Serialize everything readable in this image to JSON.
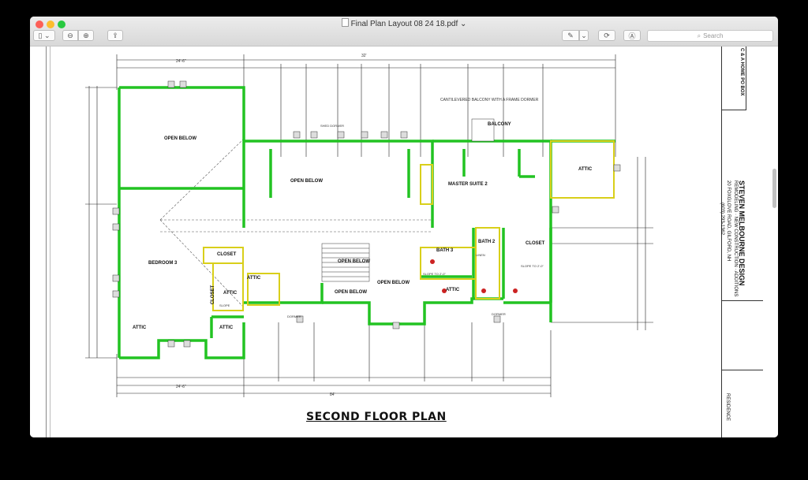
{
  "window": {
    "title": "Final Plan Layout 08 24 18.pdf",
    "title_suffix": "⌄"
  },
  "toolbar": {
    "sidebar_label": "▯ ⌄",
    "zoom_out_label": "⊖",
    "zoom_in_label": "⊕",
    "share_label": "⇪",
    "markup_label": "✎",
    "markup_menu_label": "⌄",
    "rotate_label": "⟳",
    "annotate_label": "Ⓐ",
    "search_placeholder": "Search"
  },
  "plan": {
    "title": "SECOND FLOOR PLAN",
    "rooms": {
      "open_below_1": "OPEN BELOW",
      "open_below_2": "OPEN BELOW",
      "open_below_3": "OPEN BELOW",
      "open_below_4": "OPEN BELOW",
      "open_below_5": "OPEN BELOW",
      "master_suite": "MASTER SUITE 2",
      "bedroom3": "BEDROOM 3",
      "bath3": "BATH 3",
      "bath2": "BATH 2",
      "closet1": "CLOSET",
      "closet2": "CLOSET",
      "closet3": "CLOSET",
      "attic1": "ATTIC",
      "attic2": "ATTIC",
      "attic3": "ATTIC",
      "attic4": "ATTIC",
      "attic5": "ATTIC",
      "attic6": "ATTIC",
      "balcony": "BALCONY",
      "cantilever_note": "CANTILEVERED BALCONY WITH A FRAME DORMER",
      "shed_dormer": "SHED DORMER",
      "dormer1": "DORMER",
      "dormer2": "DORMER",
      "slope_note1": "SLOPE TO 2'-0\"",
      "slope_note2": "SLOPE TO 2'-0\"",
      "slope": "SLOPE",
      "linen": "LINEN"
    },
    "dims": {
      "top_left": "24'-6\"",
      "top_mid": "32'",
      "bottom_total": "84'",
      "bottom_left": "24'-6\""
    }
  },
  "titleblock": {
    "company": "STEVEN MELBOURNE DESIGN",
    "tagline": "REMODELING · NEW CONSTRUCTION · ADDITIONS",
    "address": "20 FOXGLOVE ROAD, GILFORD, NH",
    "phone": "(603) 293-1362",
    "project": "RESIDENCE",
    "top_code": "C & A HOME PO BOX"
  },
  "colors": {
    "wall_green": "#22c322",
    "wall_yellow": "#d9cf1a",
    "line": "#1a1a1a"
  }
}
